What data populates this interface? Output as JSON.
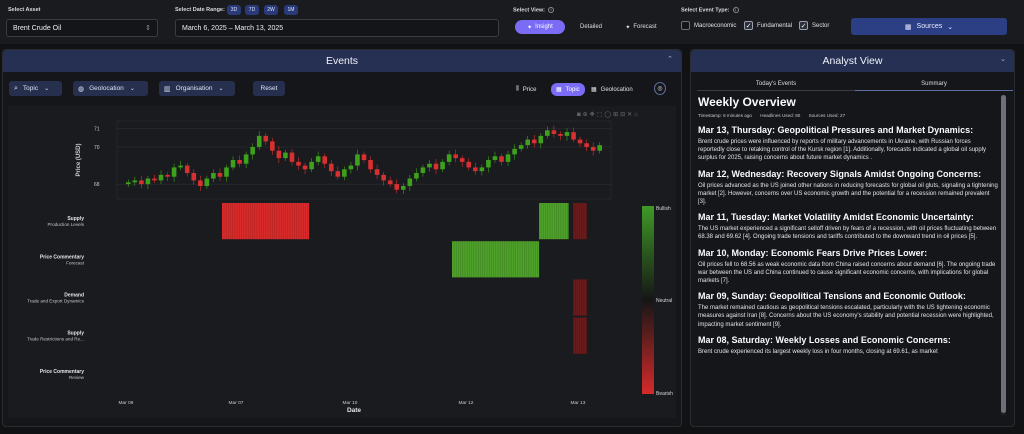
{
  "asset": {
    "label": "Select Asset",
    "value": "Brent Crude Oil"
  },
  "date_range": {
    "label": "Select Date Range:",
    "presets": [
      "3D",
      "7D",
      "2W",
      "1M"
    ],
    "value": "March 6, 2025 – March 13, 2025"
  },
  "view": {
    "label": "Select View:",
    "options": [
      "Insight",
      "Detailed",
      "Forecast"
    ],
    "selected": "Insight"
  },
  "event_type": {
    "label": "Select Event Type:",
    "options": [
      {
        "label": "Macroeconomic",
        "checked": false
      },
      {
        "label": "Fundamental",
        "checked": true
      },
      {
        "label": "Sector",
        "checked": true
      }
    ]
  },
  "sources_button": "Sources",
  "events_panel": {
    "title": "Events",
    "filters": [
      {
        "label": "Topic",
        "icon": "search-icon"
      },
      {
        "label": "Geolocation",
        "icon": "globe-icon"
      },
      {
        "label": "Organisation",
        "icon": "building-icon"
      }
    ],
    "reset_label": "Reset",
    "chart_modes": [
      "Price",
      "Topic",
      "Geolocation"
    ],
    "chart_mode_selected": "Topic"
  },
  "analyst_panel": {
    "title": "Analyst View",
    "tabs": [
      "Today's Events",
      "Summary"
    ],
    "selected_tab": "Summary",
    "heading": "Weekly Overview",
    "meta": {
      "timestamp": "Timestamp: 6 minutes ago",
      "headlines": "Headlines Used: 80",
      "sources": "Sources Used: 27"
    },
    "entries": [
      {
        "title": "Mar 13, Thursday: Geopolitical Pressures and Market Dynamics:",
        "body": " Brent crude prices were influenced by reports of military advancements in Ukraine, with Russian forces reportedly close to retaking control of the Kursk region [1]. Additionally, forecasts indicated a global oil supply surplus for 2025, raising concerns about future market dynamics ."
      },
      {
        "title": "Mar 12, Wednesday: Recovery Signals Amidst Ongoing Concerns:",
        "body": " Oil prices advanced as the US joined other nations in reducing forecasts for global oil gluts, signaling a tightening market [2]. However, concerns over US economic growth and the potential for a recession remained prevalent [3]."
      },
      {
        "title": "Mar 11, Tuesday: Market Volatility Amidst Economic Uncertainty:",
        "body": " The US market experienced a significant selloff driven by fears of a recession, with oil prices fluctuating between 68.38 and 69.62 [4]. Ongoing trade tensions and tariffs contributed to the downward trend in oil prices [5]."
      },
      {
        "title": "Mar 10, Monday: Economic Fears Drive Prices Lower:",
        "body": " Oil prices fell to 68.56 as weak economic data from China raised concerns about demand [6]. The ongoing trade war between the US and China continued to cause significant economic concerns, with implications for global markets [7]."
      },
      {
        "title": "Mar 09, Sunday: Geopolitical Tensions and Economic Outlook:",
        "body": " The market remained cautious as geopolitical tensions escalated, particularly with the US tightening economic measures against Iran [8]. Concerns about the US economy's stability and potential recession were highlighted, impacting market sentiment [9]."
      },
      {
        "title": "Mar 08, Saturday: Weekly Losses and Economic Concerns:",
        "body": " Brent crude experienced its largest weekly loss in four months, closing at 69.61, as market"
      }
    ]
  },
  "chart_data": [
    {
      "type": "candlestick",
      "title": "",
      "ylabel": "Price (USD)",
      "xlabel": "Date",
      "y_ticks": [
        68,
        70,
        71
      ],
      "ylim": [
        67.2,
        71.4
      ],
      "x_ticks": [
        "Mar 06",
        "Mar 07",
        "Mar 10",
        "Mar 12",
        "Mar 13"
      ],
      "closes": [
        68.1,
        68.2,
        68.0,
        68.3,
        68.2,
        68.5,
        68.4,
        68.9,
        69.0,
        68.6,
        68.2,
        67.9,
        68.3,
        68.6,
        68.4,
        68.9,
        69.3,
        69.1,
        69.6,
        70.0,
        70.6,
        70.3,
        69.8,
        69.4,
        69.7,
        69.2,
        69.0,
        68.8,
        69.2,
        69.5,
        69.1,
        68.7,
        68.4,
        68.8,
        69.0,
        69.6,
        69.3,
        68.8,
        68.5,
        68.2,
        68.0,
        67.7,
        67.9,
        68.3,
        68.6,
        68.9,
        69.1,
        68.8,
        69.2,
        69.6,
        69.4,
        69.2,
        68.9,
        68.7,
        68.9,
        69.3,
        69.5,
        69.2,
        69.6,
        69.9,
        70.1,
        70.4,
        70.2,
        70.6,
        70.9,
        70.7,
        70.6,
        70.8,
        70.4,
        70.2,
        70.0,
        69.8,
        70.1
      ]
    },
    {
      "type": "heatmap",
      "rows": [
        {
          "category": "Supply",
          "subcategory": "Production Levels"
        },
        {
          "category": "Price Commentary",
          "subcategory": "Forecast"
        },
        {
          "category": "Demand",
          "subcategory": "Trade and Export Dynamics"
        },
        {
          "category": "Supply",
          "subcategory": "Trade Restrictions and Re..."
        },
        {
          "category": "Price Commentary",
          "subcategory": "Review"
        }
      ],
      "x_ticks": [
        "Mar 06",
        "Mar 07",
        "Mar 10",
        "Mar 12",
        "Mar 13"
      ],
      "xlabel": "Date",
      "cells": [
        {
          "row": 0,
          "date_from": "Mar 07 00:00",
          "date_to": "Mar 07 19:00",
          "sentiment": -1.0
        },
        {
          "row": 0,
          "date_from": "Mar 12 19:00",
          "date_to": "Mar 13 01:00",
          "sentiment": 0.9
        },
        {
          "row": 0,
          "date_from": "Mar 13 02:00",
          "date_to": "Mar 13 05:00",
          "sentiment": -0.5
        },
        {
          "row": 1,
          "date_from": "Mar 12 00:00",
          "date_to": "Mar 12 19:00",
          "sentiment": 0.9
        },
        {
          "row": 2,
          "date_from": "Mar 13 02:00",
          "date_to": "Mar 13 05:00",
          "sentiment": -0.5
        },
        {
          "row": 3,
          "date_from": "Mar 13 02:00",
          "date_to": "Mar 13 05:00",
          "sentiment": -0.5
        }
      ],
      "colorscale": {
        "top": "Bullish",
        "mid": "Neutral",
        "bottom": "Bearish",
        "bullish_color": "#3f9a27",
        "bearish_color": "#d62a2a"
      }
    }
  ]
}
